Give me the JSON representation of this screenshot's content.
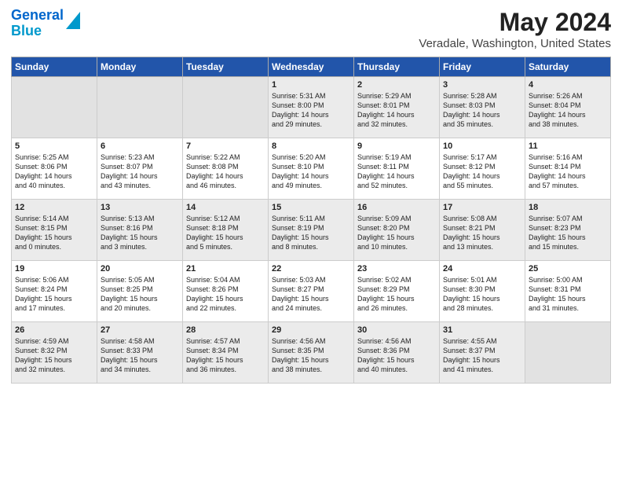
{
  "app": {
    "logo_line1": "General",
    "logo_line2": "Blue"
  },
  "header": {
    "title": "May 2024",
    "subtitle": "Veradale, Washington, United States"
  },
  "days_of_week": [
    "Sunday",
    "Monday",
    "Tuesday",
    "Wednesday",
    "Thursday",
    "Friday",
    "Saturday"
  ],
  "weeks": [
    [
      {
        "day": "",
        "info": ""
      },
      {
        "day": "",
        "info": ""
      },
      {
        "day": "",
        "info": ""
      },
      {
        "day": "1",
        "info": "Sunrise: 5:31 AM\nSunset: 8:00 PM\nDaylight: 14 hours\nand 29 minutes."
      },
      {
        "day": "2",
        "info": "Sunrise: 5:29 AM\nSunset: 8:01 PM\nDaylight: 14 hours\nand 32 minutes."
      },
      {
        "day": "3",
        "info": "Sunrise: 5:28 AM\nSunset: 8:03 PM\nDaylight: 14 hours\nand 35 minutes."
      },
      {
        "day": "4",
        "info": "Sunrise: 5:26 AM\nSunset: 8:04 PM\nDaylight: 14 hours\nand 38 minutes."
      }
    ],
    [
      {
        "day": "5",
        "info": "Sunrise: 5:25 AM\nSunset: 8:06 PM\nDaylight: 14 hours\nand 40 minutes."
      },
      {
        "day": "6",
        "info": "Sunrise: 5:23 AM\nSunset: 8:07 PM\nDaylight: 14 hours\nand 43 minutes."
      },
      {
        "day": "7",
        "info": "Sunrise: 5:22 AM\nSunset: 8:08 PM\nDaylight: 14 hours\nand 46 minutes."
      },
      {
        "day": "8",
        "info": "Sunrise: 5:20 AM\nSunset: 8:10 PM\nDaylight: 14 hours\nand 49 minutes."
      },
      {
        "day": "9",
        "info": "Sunrise: 5:19 AM\nSunset: 8:11 PM\nDaylight: 14 hours\nand 52 minutes."
      },
      {
        "day": "10",
        "info": "Sunrise: 5:17 AM\nSunset: 8:12 PM\nDaylight: 14 hours\nand 55 minutes."
      },
      {
        "day": "11",
        "info": "Sunrise: 5:16 AM\nSunset: 8:14 PM\nDaylight: 14 hours\nand 57 minutes."
      }
    ],
    [
      {
        "day": "12",
        "info": "Sunrise: 5:14 AM\nSunset: 8:15 PM\nDaylight: 15 hours\nand 0 minutes."
      },
      {
        "day": "13",
        "info": "Sunrise: 5:13 AM\nSunset: 8:16 PM\nDaylight: 15 hours\nand 3 minutes."
      },
      {
        "day": "14",
        "info": "Sunrise: 5:12 AM\nSunset: 8:18 PM\nDaylight: 15 hours\nand 5 minutes."
      },
      {
        "day": "15",
        "info": "Sunrise: 5:11 AM\nSunset: 8:19 PM\nDaylight: 15 hours\nand 8 minutes."
      },
      {
        "day": "16",
        "info": "Sunrise: 5:09 AM\nSunset: 8:20 PM\nDaylight: 15 hours\nand 10 minutes."
      },
      {
        "day": "17",
        "info": "Sunrise: 5:08 AM\nSunset: 8:21 PM\nDaylight: 15 hours\nand 13 minutes."
      },
      {
        "day": "18",
        "info": "Sunrise: 5:07 AM\nSunset: 8:23 PM\nDaylight: 15 hours\nand 15 minutes."
      }
    ],
    [
      {
        "day": "19",
        "info": "Sunrise: 5:06 AM\nSunset: 8:24 PM\nDaylight: 15 hours\nand 17 minutes."
      },
      {
        "day": "20",
        "info": "Sunrise: 5:05 AM\nSunset: 8:25 PM\nDaylight: 15 hours\nand 20 minutes."
      },
      {
        "day": "21",
        "info": "Sunrise: 5:04 AM\nSunset: 8:26 PM\nDaylight: 15 hours\nand 22 minutes."
      },
      {
        "day": "22",
        "info": "Sunrise: 5:03 AM\nSunset: 8:27 PM\nDaylight: 15 hours\nand 24 minutes."
      },
      {
        "day": "23",
        "info": "Sunrise: 5:02 AM\nSunset: 8:29 PM\nDaylight: 15 hours\nand 26 minutes."
      },
      {
        "day": "24",
        "info": "Sunrise: 5:01 AM\nSunset: 8:30 PM\nDaylight: 15 hours\nand 28 minutes."
      },
      {
        "day": "25",
        "info": "Sunrise: 5:00 AM\nSunset: 8:31 PM\nDaylight: 15 hours\nand 31 minutes."
      }
    ],
    [
      {
        "day": "26",
        "info": "Sunrise: 4:59 AM\nSunset: 8:32 PM\nDaylight: 15 hours\nand 32 minutes."
      },
      {
        "day": "27",
        "info": "Sunrise: 4:58 AM\nSunset: 8:33 PM\nDaylight: 15 hours\nand 34 minutes."
      },
      {
        "day": "28",
        "info": "Sunrise: 4:57 AM\nSunset: 8:34 PM\nDaylight: 15 hours\nand 36 minutes."
      },
      {
        "day": "29",
        "info": "Sunrise: 4:56 AM\nSunset: 8:35 PM\nDaylight: 15 hours\nand 38 minutes."
      },
      {
        "day": "30",
        "info": "Sunrise: 4:56 AM\nSunset: 8:36 PM\nDaylight: 15 hours\nand 40 minutes."
      },
      {
        "day": "31",
        "info": "Sunrise: 4:55 AM\nSunset: 8:37 PM\nDaylight: 15 hours\nand 41 minutes."
      },
      {
        "day": "",
        "info": ""
      }
    ]
  ]
}
